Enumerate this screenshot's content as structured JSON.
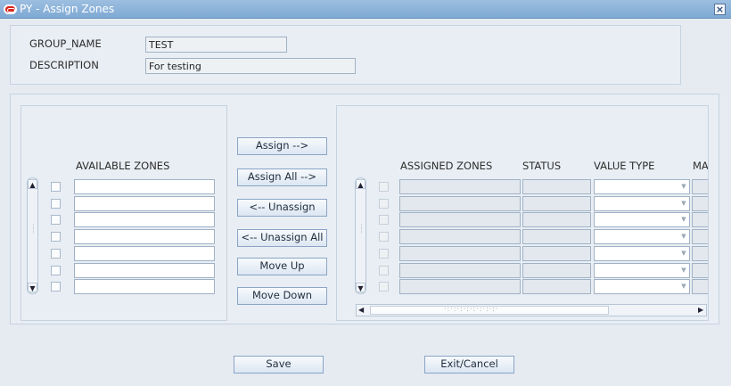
{
  "window": {
    "title": "PY - Assign Zones",
    "close_glyph": "×"
  },
  "header": {
    "group_name_label": "GROUP_NAME",
    "group_name_value": "TEST",
    "description_label": "DESCRIPTION",
    "description_value": "For testing"
  },
  "available": {
    "header": "AVAILABLE ZONES",
    "rows": [
      "",
      "",
      "",
      "",
      "",
      "",
      ""
    ]
  },
  "actions": {
    "assign": "Assign -->",
    "assign_all": "Assign All -->",
    "unassign": "<-- Unassign",
    "unassign_all": "<-- Unassign All",
    "move_up": "Move Up",
    "move_down": "Move Down"
  },
  "assigned": {
    "headers": {
      "zones": "ASSIGNED ZONES",
      "status": "STATUS",
      "value_type": "VALUE TYPE",
      "truncated": "MA"
    },
    "rows": [
      "",
      "",
      "",
      "",
      "",
      "",
      ""
    ]
  },
  "footer": {
    "save": "Save",
    "exit": "Exit/Cancel"
  }
}
